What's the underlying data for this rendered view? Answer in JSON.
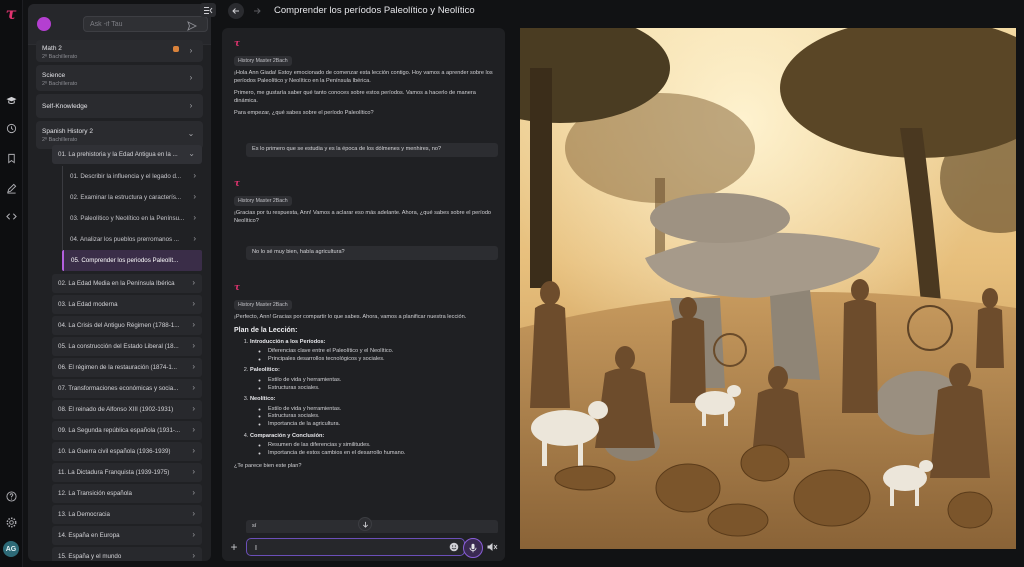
{
  "colors": {
    "accent": "#b45fe0",
    "brand": "#e0336f",
    "background": "#111214",
    "panel": "#1f2023"
  },
  "rail": {
    "logo": "τ",
    "icons": [
      "graduation-cap-icon",
      "history-icon",
      "bookmark-icon",
      "pen-icon",
      "code-icon",
      "help-icon",
      "settings-icon"
    ],
    "avatar": "AG"
  },
  "sidebar": {
    "search_placeholder": "Ask -if Tau",
    "subjects": [
      {
        "title": "Math 2",
        "subtitle": "2º Bachillerato"
      },
      {
        "title": "Science",
        "subtitle": "2º Bachillerato"
      },
      {
        "title": "Self-Knowledge",
        "subtitle": ""
      },
      {
        "title": "Spanish History 2",
        "subtitle": "2º Bachillerato"
      }
    ],
    "unit_open": "01. La prehistoria y la Edad Antigua en la ...",
    "lessons": [
      "01. Describir la influencia y el legado d...",
      "02. Examinar la estructura y caracterís...",
      "03. Paleolítico y Neolítico en la Penínsu...",
      "04. Analizar los pueblos prerromanos ...",
      "05. Comprender los periodos Paleolít..."
    ],
    "units": [
      "02. La Edad Media en la Península Ibérica",
      "03. La Edad moderna",
      "04. La Crisis del Antiguo Régimen (1788-1...",
      "05. La construcción del Estado Liberal (18...",
      "06. El régimen de la restauración (1874-1...",
      "07. Transformaciones económicas y socia...",
      "08. El reinado de Alfonso XIII (1902-1931)",
      "09. La Segunda república española (1931-...",
      "10. La Guerra civil española (1936-1939)",
      "11. La Dictadura Franquista (1939-1975)",
      "12. La Transición española",
      "13. La Democracia",
      "14. España en Europa",
      "15. España y el mundo"
    ]
  },
  "header": {
    "title": "Comprender los períodos Paleolítico y Neolítico"
  },
  "chat": {
    "tag": "History Master 2Bach",
    "m1": [
      "¡Hola Ann Giada! Estoy emocionado de comenzar esta lección contigo. Hoy vamos a aprender sobre los períodos Paleolítico y Neolítico en la Península Ibérica.",
      "Primero, me gustaría saber qué tanto conoces sobre estos períodos. Vamos a hacerlo de manera dinámica.",
      "Para empezar, ¿qué sabes sobre el período Paleolítico?"
    ],
    "u1": "Es lo primero que se estudia y es la época de los dólmenes y menhires, no?",
    "m2": "¡Gracias por tu respuesta, Ann! Vamos a aclarar eso más adelante. Ahora, ¿qué sabes sobre el período Neolítico?",
    "u2": "No lo sé muy bien, había agricultura?",
    "m3": "¡Perfecto, Ann! Gracias por compartir lo que sabes. Ahora, vamos a planificar nuestra lección.",
    "plan_title": "Plan de la Lección:",
    "plan": [
      {
        "title": "Introducción a los Períodos:",
        "items": [
          "Diferencias clave entre el Paleolítico y el Neolítico.",
          "Principales desarrollos tecnológicos y sociales."
        ]
      },
      {
        "title": "Paleolítico:",
        "items": [
          "Estilo de vida y herramientas.",
          "Estructuras sociales."
        ]
      },
      {
        "title": "Neolítico:",
        "items": [
          "Estilo de vida y herramientas.",
          "Estructuras sociales.",
          "Importancia de la agricultura."
        ]
      },
      {
        "title": "Comparación y Conclusión:",
        "items": [
          "Resumen de las diferencias y similitudes.",
          "Importancia de estos cambios en el desarrollo humano."
        ]
      }
    ],
    "closing": "¿Te parece bien este plan?",
    "u3": "sí",
    "input_value": "I"
  },
  "image": {
    "subject": "Neolithic village scene with dolmen, goats and people weaving baskets"
  }
}
